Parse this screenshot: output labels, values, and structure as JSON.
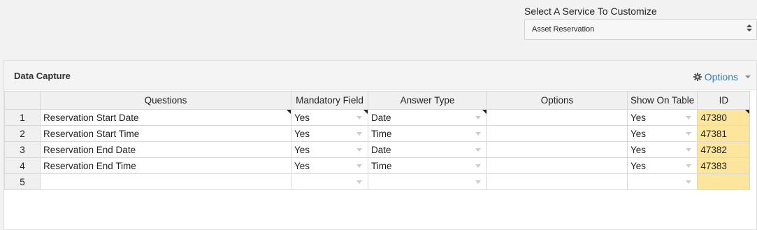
{
  "service": {
    "label": "Select A Service To Customize",
    "selected": "Asset Reservation"
  },
  "panel": {
    "title": "Data Capture",
    "options_label": "Options"
  },
  "table": {
    "headers": [
      "Questions",
      "Mandatory Field",
      "Answer Type",
      "Options",
      "Show On Table",
      "ID"
    ],
    "rows": [
      {
        "num": "1",
        "question": "Reservation Start Date",
        "mandatory": "Yes",
        "answer_type": "Date",
        "options": "",
        "show": "Yes",
        "id": "47380"
      },
      {
        "num": "2",
        "question": "Reservation Start Time",
        "mandatory": "Yes",
        "answer_type": "Time",
        "options": "",
        "show": "Yes",
        "id": "47381"
      },
      {
        "num": "3",
        "question": "Reservation End Date",
        "mandatory": "Yes",
        "answer_type": "Date",
        "options": "",
        "show": "Yes",
        "id": "47382"
      },
      {
        "num": "4",
        "question": "Reservation End Time",
        "mandatory": "Yes",
        "answer_type": "Time",
        "options": "",
        "show": "Yes",
        "id": "47383"
      },
      {
        "num": "5",
        "question": "",
        "mandatory": "",
        "answer_type": "",
        "options": "",
        "show": "",
        "id": ""
      }
    ]
  },
  "icons": {
    "options_menu": "gear-icon",
    "options_caret": "chevron-down-icon",
    "select_arrows": "up-down-arrows-icon",
    "cell_dropdown": "dropdown-arrow-icon",
    "comment_marker": "comment-triangle-icon"
  },
  "colors": {
    "link": "#3a7ab8",
    "id_cell": "#fde69b",
    "header_bg": "#f0f0f0"
  }
}
